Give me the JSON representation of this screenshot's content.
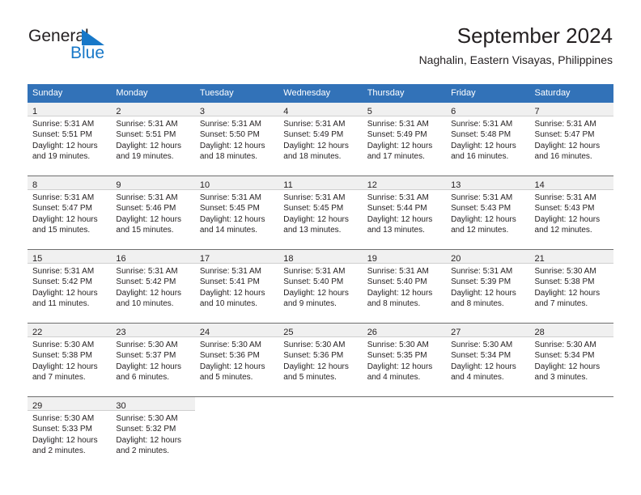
{
  "logo": {
    "word_one": "General",
    "word_two": "Blue",
    "triangle_icon": "triangle-icon",
    "accent_color": "#1878c8"
  },
  "header": {
    "title": "September 2024",
    "subtitle": "Naghalin, Eastern Visayas, Philippines"
  },
  "theme": {
    "header_blue": "#3272b8",
    "daynum_bg": "#f0f0f0",
    "text": "#231f20",
    "separator": "#6e6e6e"
  },
  "weekdays": [
    "Sunday",
    "Monday",
    "Tuesday",
    "Wednesday",
    "Thursday",
    "Friday",
    "Saturday"
  ],
  "weeks": [
    [
      {
        "day": "1",
        "sunrise": "Sunrise: 5:31 AM",
        "sunset": "Sunset: 5:51 PM",
        "daylight_1": "Daylight: 12 hours",
        "daylight_2": "and 19 minutes."
      },
      {
        "day": "2",
        "sunrise": "Sunrise: 5:31 AM",
        "sunset": "Sunset: 5:51 PM",
        "daylight_1": "Daylight: 12 hours",
        "daylight_2": "and 19 minutes."
      },
      {
        "day": "3",
        "sunrise": "Sunrise: 5:31 AM",
        "sunset": "Sunset: 5:50 PM",
        "daylight_1": "Daylight: 12 hours",
        "daylight_2": "and 18 minutes."
      },
      {
        "day": "4",
        "sunrise": "Sunrise: 5:31 AM",
        "sunset": "Sunset: 5:49 PM",
        "daylight_1": "Daylight: 12 hours",
        "daylight_2": "and 18 minutes."
      },
      {
        "day": "5",
        "sunrise": "Sunrise: 5:31 AM",
        "sunset": "Sunset: 5:49 PM",
        "daylight_1": "Daylight: 12 hours",
        "daylight_2": "and 17 minutes."
      },
      {
        "day": "6",
        "sunrise": "Sunrise: 5:31 AM",
        "sunset": "Sunset: 5:48 PM",
        "daylight_1": "Daylight: 12 hours",
        "daylight_2": "and 16 minutes."
      },
      {
        "day": "7",
        "sunrise": "Sunrise: 5:31 AM",
        "sunset": "Sunset: 5:47 PM",
        "daylight_1": "Daylight: 12 hours",
        "daylight_2": "and 16 minutes."
      }
    ],
    [
      {
        "day": "8",
        "sunrise": "Sunrise: 5:31 AM",
        "sunset": "Sunset: 5:47 PM",
        "daylight_1": "Daylight: 12 hours",
        "daylight_2": "and 15 minutes."
      },
      {
        "day": "9",
        "sunrise": "Sunrise: 5:31 AM",
        "sunset": "Sunset: 5:46 PM",
        "daylight_1": "Daylight: 12 hours",
        "daylight_2": "and 15 minutes."
      },
      {
        "day": "10",
        "sunrise": "Sunrise: 5:31 AM",
        "sunset": "Sunset: 5:45 PM",
        "daylight_1": "Daylight: 12 hours",
        "daylight_2": "and 14 minutes."
      },
      {
        "day": "11",
        "sunrise": "Sunrise: 5:31 AM",
        "sunset": "Sunset: 5:45 PM",
        "daylight_1": "Daylight: 12 hours",
        "daylight_2": "and 13 minutes."
      },
      {
        "day": "12",
        "sunrise": "Sunrise: 5:31 AM",
        "sunset": "Sunset: 5:44 PM",
        "daylight_1": "Daylight: 12 hours",
        "daylight_2": "and 13 minutes."
      },
      {
        "day": "13",
        "sunrise": "Sunrise: 5:31 AM",
        "sunset": "Sunset: 5:43 PM",
        "daylight_1": "Daylight: 12 hours",
        "daylight_2": "and 12 minutes."
      },
      {
        "day": "14",
        "sunrise": "Sunrise: 5:31 AM",
        "sunset": "Sunset: 5:43 PM",
        "daylight_1": "Daylight: 12 hours",
        "daylight_2": "and 12 minutes."
      }
    ],
    [
      {
        "day": "15",
        "sunrise": "Sunrise: 5:31 AM",
        "sunset": "Sunset: 5:42 PM",
        "daylight_1": "Daylight: 12 hours",
        "daylight_2": "and 11 minutes."
      },
      {
        "day": "16",
        "sunrise": "Sunrise: 5:31 AM",
        "sunset": "Sunset: 5:42 PM",
        "daylight_1": "Daylight: 12 hours",
        "daylight_2": "and 10 minutes."
      },
      {
        "day": "17",
        "sunrise": "Sunrise: 5:31 AM",
        "sunset": "Sunset: 5:41 PM",
        "daylight_1": "Daylight: 12 hours",
        "daylight_2": "and 10 minutes."
      },
      {
        "day": "18",
        "sunrise": "Sunrise: 5:31 AM",
        "sunset": "Sunset: 5:40 PM",
        "daylight_1": "Daylight: 12 hours",
        "daylight_2": "and 9 minutes."
      },
      {
        "day": "19",
        "sunrise": "Sunrise: 5:31 AM",
        "sunset": "Sunset: 5:40 PM",
        "daylight_1": "Daylight: 12 hours",
        "daylight_2": "and 8 minutes."
      },
      {
        "day": "20",
        "sunrise": "Sunrise: 5:31 AM",
        "sunset": "Sunset: 5:39 PM",
        "daylight_1": "Daylight: 12 hours",
        "daylight_2": "and 8 minutes."
      },
      {
        "day": "21",
        "sunrise": "Sunrise: 5:30 AM",
        "sunset": "Sunset: 5:38 PM",
        "daylight_1": "Daylight: 12 hours",
        "daylight_2": "and 7 minutes."
      }
    ],
    [
      {
        "day": "22",
        "sunrise": "Sunrise: 5:30 AM",
        "sunset": "Sunset: 5:38 PM",
        "daylight_1": "Daylight: 12 hours",
        "daylight_2": "and 7 minutes."
      },
      {
        "day": "23",
        "sunrise": "Sunrise: 5:30 AM",
        "sunset": "Sunset: 5:37 PM",
        "daylight_1": "Daylight: 12 hours",
        "daylight_2": "and 6 minutes."
      },
      {
        "day": "24",
        "sunrise": "Sunrise: 5:30 AM",
        "sunset": "Sunset: 5:36 PM",
        "daylight_1": "Daylight: 12 hours",
        "daylight_2": "and 5 minutes."
      },
      {
        "day": "25",
        "sunrise": "Sunrise: 5:30 AM",
        "sunset": "Sunset: 5:36 PM",
        "daylight_1": "Daylight: 12 hours",
        "daylight_2": "and 5 minutes."
      },
      {
        "day": "26",
        "sunrise": "Sunrise: 5:30 AM",
        "sunset": "Sunset: 5:35 PM",
        "daylight_1": "Daylight: 12 hours",
        "daylight_2": "and 4 minutes."
      },
      {
        "day": "27",
        "sunrise": "Sunrise: 5:30 AM",
        "sunset": "Sunset: 5:34 PM",
        "daylight_1": "Daylight: 12 hours",
        "daylight_2": "and 4 minutes."
      },
      {
        "day": "28",
        "sunrise": "Sunrise: 5:30 AM",
        "sunset": "Sunset: 5:34 PM",
        "daylight_1": "Daylight: 12 hours",
        "daylight_2": "and 3 minutes."
      }
    ],
    [
      {
        "day": "29",
        "sunrise": "Sunrise: 5:30 AM",
        "sunset": "Sunset: 5:33 PM",
        "daylight_1": "Daylight: 12 hours",
        "daylight_2": "and 2 minutes."
      },
      {
        "day": "30",
        "sunrise": "Sunrise: 5:30 AM",
        "sunset": "Sunset: 5:32 PM",
        "daylight_1": "Daylight: 12 hours",
        "daylight_2": "and 2 minutes."
      },
      null,
      null,
      null,
      null,
      null
    ]
  ]
}
